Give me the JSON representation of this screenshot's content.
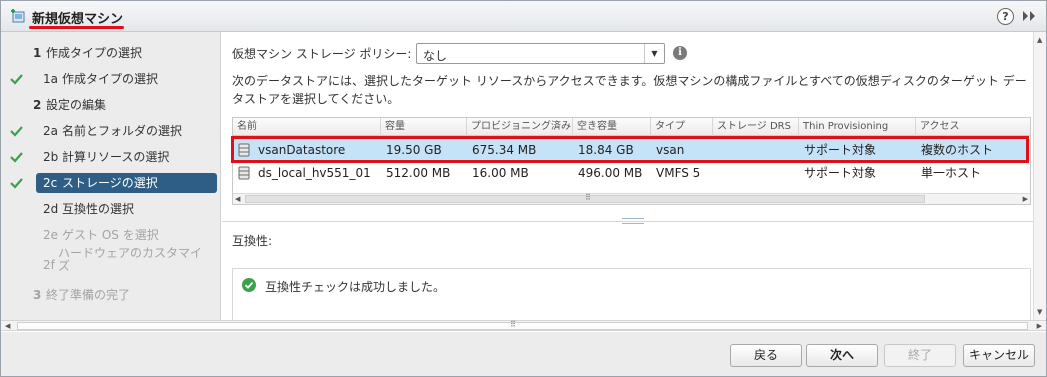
{
  "window": {
    "title": "新規仮想マシン",
    "help_label": "?",
    "accent_color": "#e0101a"
  },
  "steps": [
    {
      "num": "1",
      "label": "作成タイプの選択",
      "done": false,
      "state": "normal"
    },
    {
      "num": "1a",
      "label": "作成タイプの選択",
      "done": true,
      "state": "normal"
    },
    {
      "num": "2",
      "label": "設定の編集",
      "done": false,
      "state": "normal"
    },
    {
      "num": "2a",
      "label": "名前とフォルダの選択",
      "done": true,
      "state": "normal"
    },
    {
      "num": "2b",
      "label": "計算リソースの選択",
      "done": true,
      "state": "normal"
    },
    {
      "num": "2c",
      "label": "ストレージの選択",
      "done": true,
      "state": "selected"
    },
    {
      "num": "2d",
      "label": "互換性の選択",
      "done": false,
      "state": "normal"
    },
    {
      "num": "2e",
      "label": "ゲスト OS を選択",
      "done": false,
      "state": "disabled"
    },
    {
      "num": "2f",
      "label": "ハードウェアのカスタマイズ",
      "done": false,
      "state": "disabled"
    },
    {
      "num": "3",
      "label": "終了準備の完了",
      "done": false,
      "state": "disabled"
    }
  ],
  "storage": {
    "policy_label": "仮想マシン ストレージ ポリシー:",
    "policy_value": "なし",
    "description": "次のデータストアには、選択したターゲット リソースからアクセスできます。仮想マシンの構成ファイルとすべての仮想ディスクのターゲット データストアを選択してください。",
    "columns": [
      "名前",
      "容量",
      "プロビジョニング済み",
      "空き容量",
      "タイプ",
      "ストレージ DRS",
      "Thin Provisioning",
      "アクセス"
    ],
    "rows": [
      {
        "name": "vsanDatastore",
        "capacity": "19.50 GB",
        "provisioned": "675.34 MB",
        "free": "18.84 GB",
        "type": "vsan",
        "drs": "",
        "thin": "サポート対象",
        "access": "複数のホスト",
        "selected": true
      },
      {
        "name": "ds_local_hv551_01",
        "capacity": "512.00 MB",
        "provisioned": "16.00 MB",
        "free": "496.00 MB",
        "type": "VMFS 5",
        "drs": "",
        "thin": "サポート対象",
        "access": "単一ホスト",
        "selected": false
      }
    ]
  },
  "compat": {
    "label": "互換性:",
    "message": "互換性チェックは成功しました。"
  },
  "buttons": {
    "back": "戻る",
    "next": "次へ",
    "finish": "終了",
    "cancel": "キャンセル"
  }
}
